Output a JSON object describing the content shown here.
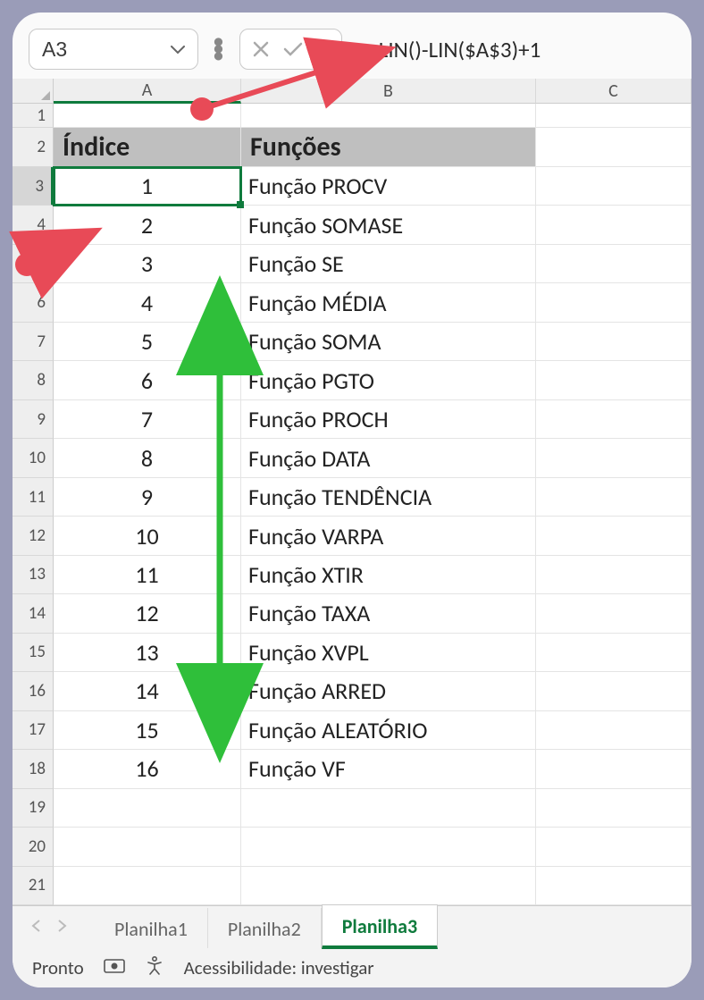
{
  "formula_bar": {
    "cell_ref": "A3",
    "formula": "=LIN()-LIN($A$3)+1"
  },
  "columns": [
    "A",
    "B",
    "C"
  ],
  "headers": {
    "indice": "Índice",
    "funcoes": "Funções"
  },
  "rows": [
    {
      "n": 3,
      "idx": "1",
      "fn": "Função PROCV"
    },
    {
      "n": 4,
      "idx": "2",
      "fn": "Função SOMASE"
    },
    {
      "n": 5,
      "idx": "3",
      "fn": "Função SE"
    },
    {
      "n": 6,
      "idx": "4",
      "fn": "Função MÉDIA"
    },
    {
      "n": 7,
      "idx": "5",
      "fn": "Função SOMA"
    },
    {
      "n": 8,
      "idx": "6",
      "fn": "Função PGTO"
    },
    {
      "n": 9,
      "idx": "7",
      "fn": "Função PROCH"
    },
    {
      "n": 10,
      "idx": "8",
      "fn": "Função DATA"
    },
    {
      "n": 11,
      "idx": "9",
      "fn": "Função TENDÊNCIA"
    },
    {
      "n": 12,
      "idx": "10",
      "fn": "Função VARPA"
    },
    {
      "n": 13,
      "idx": "11",
      "fn": "Função XTIR"
    },
    {
      "n": 14,
      "idx": "12",
      "fn": "Função TAXA"
    },
    {
      "n": 15,
      "idx": "13",
      "fn": "Função XVPL"
    },
    {
      "n": 16,
      "idx": "14",
      "fn": "Função ARRED"
    },
    {
      "n": 17,
      "idx": "15",
      "fn": "Função ALEATÓRIO"
    },
    {
      "n": 18,
      "idx": "16",
      "fn": "Função VF"
    }
  ],
  "empty_rows": [
    19,
    20,
    21
  ],
  "sheet_tabs": [
    "Planilha1",
    "Planilha2",
    "Planilha3"
  ],
  "active_tab": 2,
  "selected_cell_row": 3,
  "status": {
    "ready": "Pronto",
    "accessibility": "Acessibilidade: investigar"
  }
}
